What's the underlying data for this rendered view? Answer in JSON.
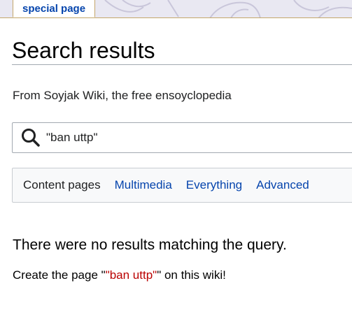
{
  "header": {
    "tab_label": "special page"
  },
  "main": {
    "title": "Search results",
    "subtitle": "From Soyjak Wiki, the free ensoyclopedia",
    "search": {
      "value": "\"ban uttp\"",
      "icon": "search-icon"
    },
    "profiles": [
      {
        "label": "Content pages",
        "current": true
      },
      {
        "label": "Multimedia",
        "current": false
      },
      {
        "label": "Everything",
        "current": false
      },
      {
        "label": "Advanced",
        "current": false
      }
    ],
    "no_results": "There were no results matching the query.",
    "create": {
      "prefix": "Create the page \"",
      "link": "\"ban uttp\"",
      "suffix": "\" on this wiki!"
    }
  },
  "colors": {
    "link": "#0645ad",
    "redlink": "#ba0000",
    "tab_border": "#c4a66a",
    "header_bg": "#e9e8f2"
  }
}
